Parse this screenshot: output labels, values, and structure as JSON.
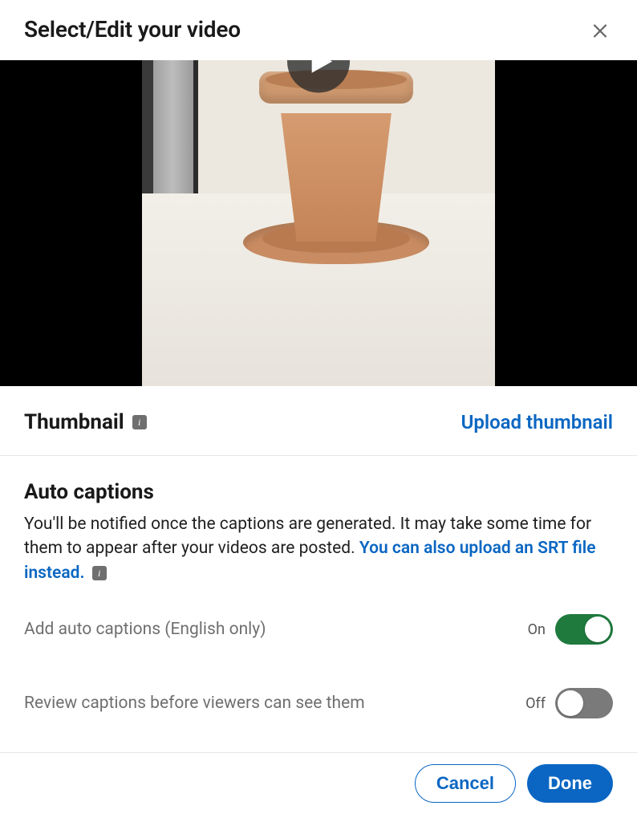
{
  "header": {
    "title": "Select/Edit your video"
  },
  "video": {
    "play_icon": "play-icon"
  },
  "thumbnail": {
    "label": "Thumbnail",
    "upload_link": "Upload thumbnail"
  },
  "captions": {
    "heading": "Auto captions",
    "desc_part1": "You'll be notified once the captions are generated. It may take some time for them to appear after your videos are posted. ",
    "srt_link": "You can also upload an SRT file instead.",
    "toggle_add": {
      "label": "Add auto captions (English only)",
      "state": "On",
      "value": true
    },
    "toggle_review": {
      "label": "Review captions before viewers can see them",
      "state": "Off",
      "value": false
    }
  },
  "footer": {
    "cancel": "Cancel",
    "done": "Done"
  },
  "colors": {
    "link": "#0a66c2",
    "toggle_on": "#1f7a3e"
  }
}
